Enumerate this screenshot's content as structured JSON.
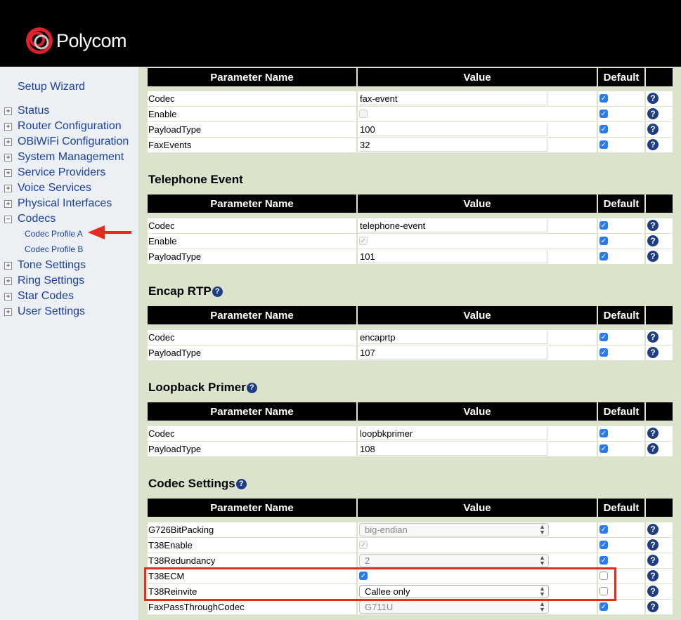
{
  "brand": {
    "name": "Polycom"
  },
  "sidebar": {
    "setup_wizard": "Setup Wizard",
    "items": [
      {
        "label": "Status",
        "toggle": "+"
      },
      {
        "label": "Router Configuration",
        "toggle": "+"
      },
      {
        "label": "OBiWiFi Configuration",
        "toggle": "+"
      },
      {
        "label": "System Management",
        "toggle": "+"
      },
      {
        "label": "Service Providers",
        "toggle": "+"
      },
      {
        "label": "Voice Services",
        "toggle": "+"
      },
      {
        "label": "Physical Interfaces",
        "toggle": "+"
      },
      {
        "label": "Codecs",
        "toggle": "−"
      },
      {
        "label": "Tone Settings",
        "toggle": "+"
      },
      {
        "label": "Ring Settings",
        "toggle": "+"
      },
      {
        "label": "Star Codes",
        "toggle": "+"
      },
      {
        "label": "User Settings",
        "toggle": "+"
      }
    ],
    "subitems": [
      {
        "label": "Codec Profile A"
      },
      {
        "label": "Codec Profile B"
      }
    ]
  },
  "headers": {
    "name": "Parameter Name",
    "value": "Value",
    "default": "Default",
    "help": "?"
  },
  "fax_event": {
    "rows": [
      {
        "name": "Codec",
        "value": "fax-event"
      },
      {
        "name": "Enable",
        "value": ""
      },
      {
        "name": "PayloadType",
        "value": "100"
      },
      {
        "name": "FaxEvents",
        "value": "32"
      }
    ]
  },
  "telephone_event": {
    "title": "Telephone Event",
    "rows": [
      {
        "name": "Codec",
        "value": "telephone-event"
      },
      {
        "name": "Enable",
        "value": ""
      },
      {
        "name": "PayloadType",
        "value": "101"
      }
    ]
  },
  "encap_rtp": {
    "title": "Encap RTP",
    "rows": [
      {
        "name": "Codec",
        "value": "encaprtp"
      },
      {
        "name": "PayloadType",
        "value": "107"
      }
    ]
  },
  "loopback_primer": {
    "title": "Loopback Primer",
    "rows": [
      {
        "name": "Codec",
        "value": "loopbkprimer"
      },
      {
        "name": "PayloadType",
        "value": "108"
      }
    ]
  },
  "codec_settings": {
    "title": "Codec Settings",
    "rows": [
      {
        "name": "G726BitPacking",
        "value": "big-endian"
      },
      {
        "name": "T38Enable",
        "value": ""
      },
      {
        "name": "T38Redundancy",
        "value": "2"
      },
      {
        "name": "T38ECM",
        "value": ""
      },
      {
        "name": "T38Reinvite",
        "value": "Callee only"
      },
      {
        "name": "FaxPassThroughCodec",
        "value": "G711U"
      }
    ]
  },
  "colors": {
    "accent": "#1a3fa8",
    "highlight": "#e8291c",
    "checkbox": "#2a7bf0",
    "page_bg": "#dbe3cd"
  }
}
